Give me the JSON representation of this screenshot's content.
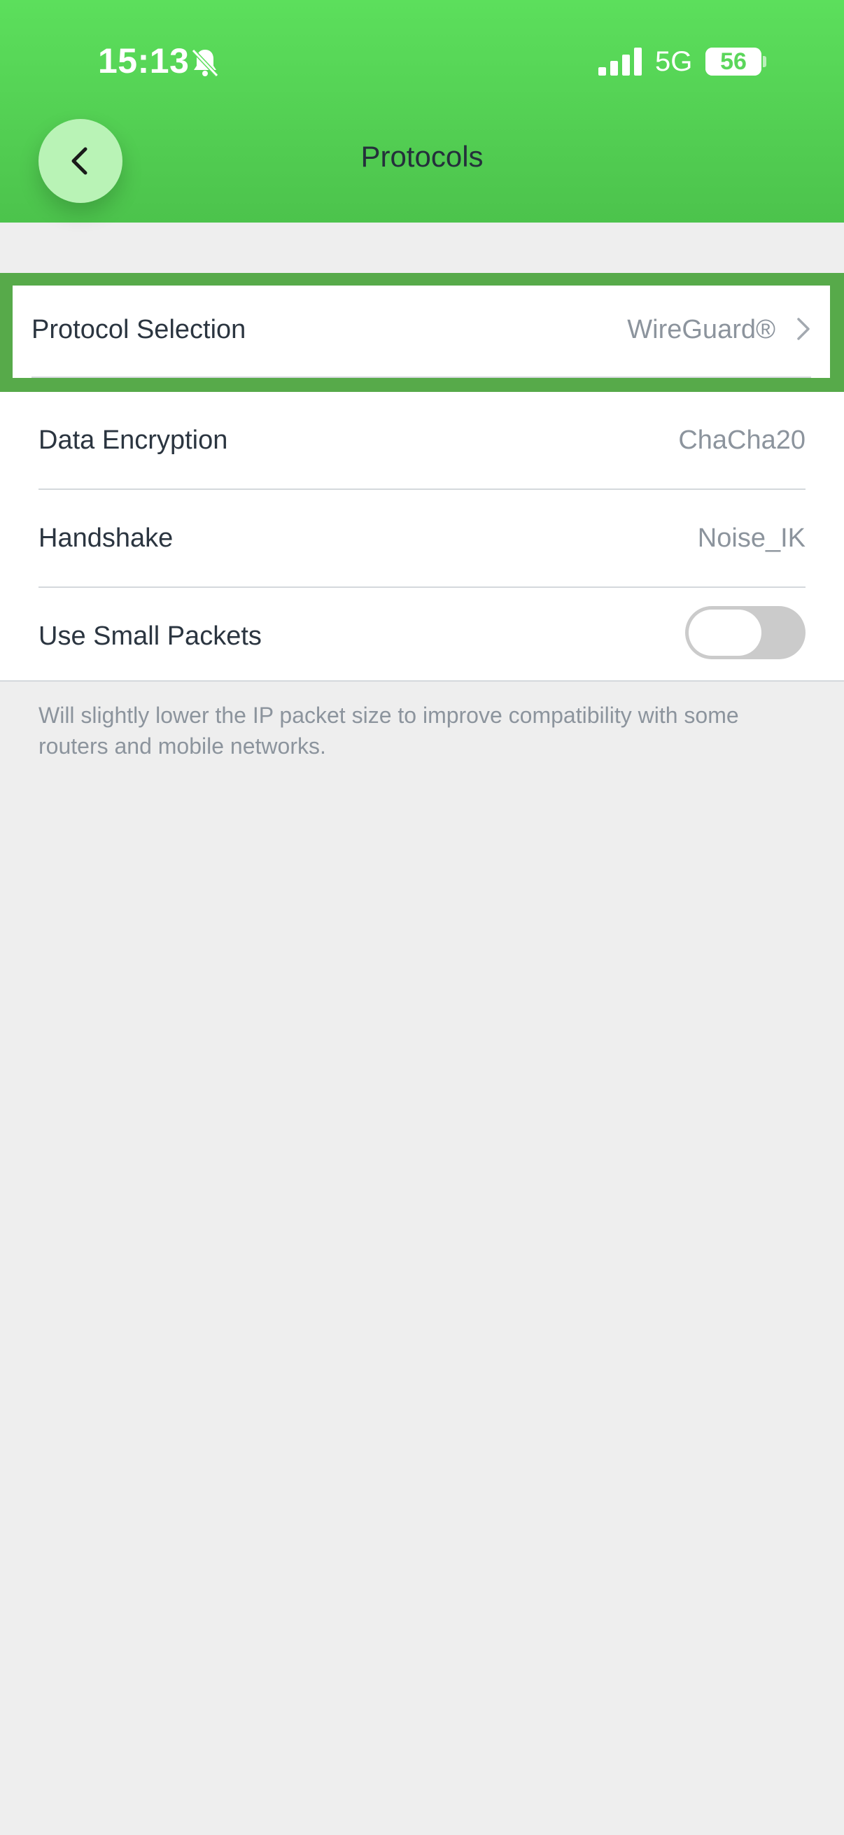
{
  "status_bar": {
    "time": "15:13",
    "network": "5G",
    "battery": "56",
    "battery_level_percent": 56
  },
  "header": {
    "title": "Protocols"
  },
  "settings": {
    "protocol_selection": {
      "label": "Protocol Selection",
      "value": "WireGuard®"
    },
    "data_encryption": {
      "label": "Data Encryption",
      "value": "ChaCha20"
    },
    "handshake": {
      "label": "Handshake",
      "value": "Noise_IK"
    },
    "small_packets": {
      "label": "Use Small Packets",
      "enabled": false
    }
  },
  "footer": {
    "note": "Will slightly lower the IP packet size to improve compatibility with some routers and mobile networks."
  },
  "colors": {
    "header_green": "#5cdf5c",
    "highlight_border": "#57aa4a",
    "back_button": "#b9f3b6"
  }
}
